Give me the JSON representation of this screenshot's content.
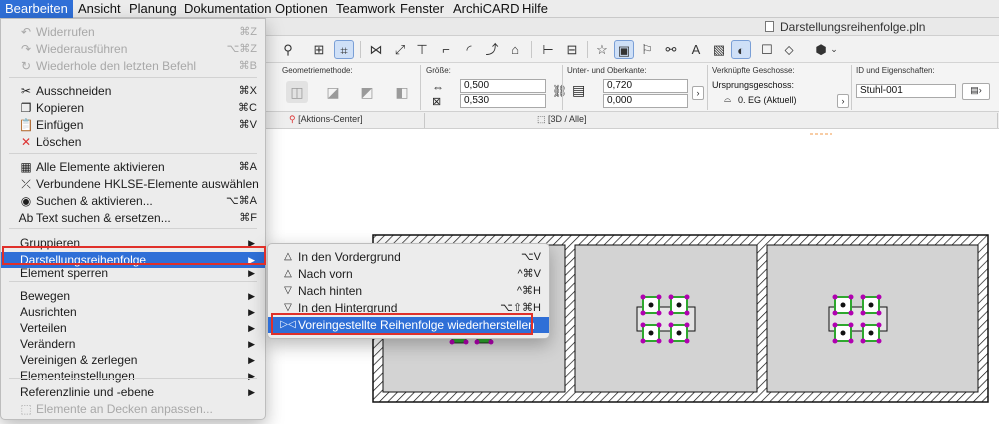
{
  "menubar": {
    "items": [
      "Bearbeiten",
      "Ansicht",
      "Planung",
      "Dokumentation",
      "Optionen",
      "Teamwork",
      "Fenster",
      "ArchiCARD",
      "Hilfe"
    ],
    "active_index": 0
  },
  "window": {
    "file_title": "Darstellungsreihenfolge.pln"
  },
  "toolbar": {
    "icons": [
      "lock-icon",
      "person-icon",
      "grid-select-icon",
      "marquee-select-icon",
      "dimension-icon",
      "level-icon",
      "elevation-dim-icon",
      "angle-dim-icon",
      "radial-dim-icon",
      "label-icon",
      "home-icon",
      "section-icon",
      "elevation-icon",
      "star-icon",
      "display-order-icon",
      "flag-icon",
      "find-icon",
      "text-icon",
      "image-icon",
      "3d-shade-icon",
      "tag-icon",
      "render-icon"
    ]
  },
  "infobox": {
    "geometry_label": "Geometriemethode:",
    "size_label": "Größe:",
    "size_width": "0,500",
    "size_depth": "0,530",
    "top_bottom_label": "Unter- und Oberkante:",
    "top_value": "0,720",
    "bottom_value": "0,000",
    "story_label": "Verknüpfte Geschosse:",
    "home_story_label": "Ursprungsgeschoss:",
    "home_story_value": "0. EG (Aktuell)",
    "id_label": "ID und Eigenschaften:",
    "id_value": "Stuhl-001"
  },
  "viewtabs": {
    "action_center": "[Aktions-Center]",
    "view_3d": "[3D / Alle]"
  },
  "edit_menu": {
    "groups": [
      [
        {
          "icon": "undo-icon",
          "glyph": "↶",
          "label": "Widerrufen",
          "shortcut": "⌘Z",
          "disabled": true
        },
        {
          "icon": "redo-icon",
          "glyph": "↷",
          "label": "Wiederausführen",
          "shortcut": "⌥⌘Z",
          "disabled": true
        },
        {
          "icon": "repeat-icon",
          "glyph": "↻",
          "label": "Wiederhole den letzten Befehl",
          "shortcut": "⌘B",
          "disabled": true
        }
      ],
      [
        {
          "icon": "scissors-icon",
          "glyph": "✂",
          "label": "Ausschneiden",
          "shortcut": "⌘X"
        },
        {
          "icon": "copy-icon",
          "glyph": "❐",
          "label": "Kopieren",
          "shortcut": "⌘C"
        },
        {
          "icon": "paste-icon",
          "glyph": "📋",
          "label": "Einfügen",
          "shortcut": "⌘V"
        },
        {
          "icon": "delete-icon",
          "glyph": "✕",
          "label": "Löschen",
          "shortcut": ""
        }
      ],
      [
        {
          "icon": "select-all-icon",
          "glyph": "▦",
          "label": "Alle Elemente aktivieren",
          "shortcut": "⌘A"
        },
        {
          "icon": "mep-select-icon",
          "glyph": "⤫",
          "label": "Verbundene HKLSE-Elemente auswählen",
          "shortcut": ""
        },
        {
          "icon": "find-select-icon",
          "glyph": "◉",
          "label": "Suchen & aktivieren...",
          "shortcut": "⌥⌘A"
        },
        {
          "icon": "find-replace-icon",
          "glyph": "Ab",
          "label": "Text suchen & ersetzen...",
          "shortcut": "⌘F"
        }
      ],
      [
        {
          "label": "Gruppieren",
          "submenu": true
        },
        {
          "label": "Darstellungsreihenfolge",
          "submenu": true,
          "highlighted": true
        },
        {
          "label": "Element sperren",
          "submenu": true
        }
      ],
      [
        {
          "label": "Bewegen",
          "submenu": true
        },
        {
          "label": "Ausrichten",
          "submenu": true
        },
        {
          "label": "Verteilen",
          "submenu": true
        },
        {
          "label": "Verändern",
          "submenu": true
        },
        {
          "label": "Vereinigen & zerlegen",
          "submenu": true
        },
        {
          "label": "Elementeinstellungen",
          "submenu": true
        }
      ],
      [
        {
          "label": "Referenzlinie und -ebene",
          "submenu": true
        },
        {
          "icon": "fit-slab-icon",
          "glyph": "⬚",
          "label": "Elemente an Decken anpassen...",
          "shortcut": "",
          "disabled": true
        }
      ]
    ]
  },
  "order_submenu": {
    "items": [
      {
        "icon": "bring-to-front-icon",
        "glyph": "△",
        "label": "In den Vordergrund",
        "shortcut": "⌥V"
      },
      {
        "icon": "bring-forward-icon",
        "glyph": "△",
        "label": "Nach vorn",
        "shortcut": "^⌘V"
      },
      {
        "icon": "send-backward-icon",
        "glyph": "▽",
        "label": "Nach hinten",
        "shortcut": "^⌘H"
      },
      {
        "icon": "send-to-back-icon",
        "glyph": "▽",
        "label": "In den Hintergrund",
        "shortcut": "⌥⇧⌘H"
      },
      {
        "icon": "reset-order-icon",
        "glyph": "▷◁",
        "label": "Voreingestellte Reihenfolge wiederherstellen",
        "shortcut": "",
        "highlighted": true
      }
    ]
  },
  "colors": {
    "menu_highlight": "#2f6fd7",
    "annotation_red": "#e0302a",
    "room_fill": "#d3d3d3",
    "chair_node": "#b100b1",
    "chair_leg": "#2ea82e"
  }
}
